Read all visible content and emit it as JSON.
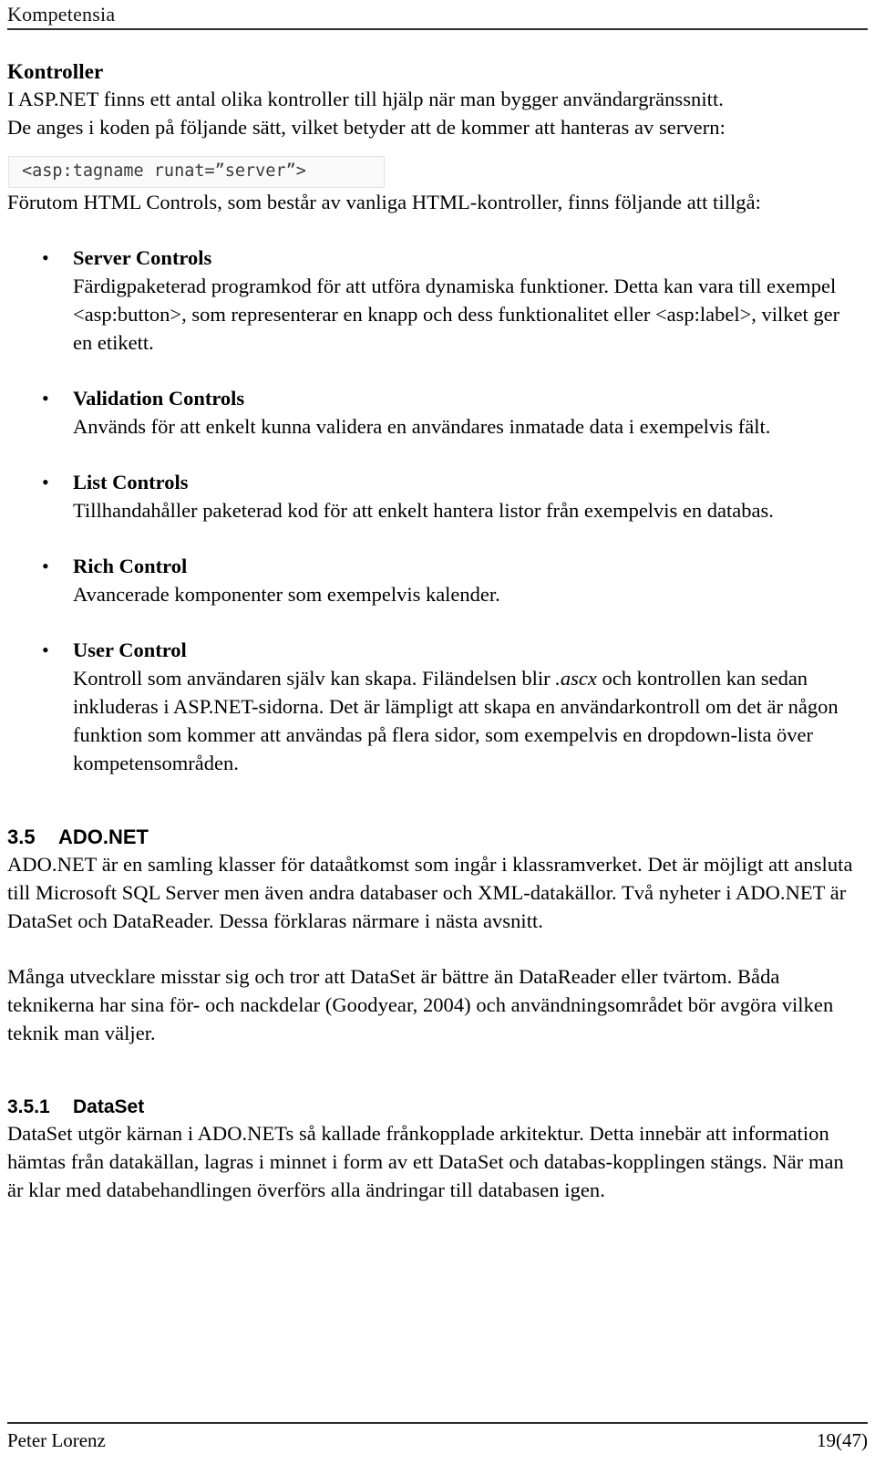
{
  "header": {
    "running_title": "Kompetensia"
  },
  "sections": {
    "kontroller": {
      "heading": "Kontroller",
      "intro_line1": "I ASP.NET finns ett antal olika kontroller till hjälp när man bygger användargränssnitt.",
      "intro_line2": "De anges i koden på följande sätt, vilket betyder att de kommer att hanteras av servern:",
      "code_snippet": "<asp:tagname runat=”server”>",
      "after_code": "Förutom HTML Controls, som består av vanliga HTML-kontroller, finns följande att tillgå:",
      "bullet_marker": "•",
      "items": [
        {
          "title": "Server Controls",
          "body": "Färdigpaketerad programkod för att utföra dynamiska funktioner. Detta kan vara till exempel <asp:button>, som representerar en knapp och dess funktionalitet eller <asp:label>, vilket ger en etikett."
        },
        {
          "title": "Validation Controls",
          "body": "Används för att enkelt kunna validera en användares inmatade data i exempelvis fält."
        },
        {
          "title": "List Controls",
          "body": "Tillhandahåller paketerad kod för att enkelt hantera listor från exempelvis en databas."
        },
        {
          "title": "Rich Control",
          "body": "Avancerade komponenter som exempelvis kalender."
        },
        {
          "title": "User Control",
          "body_part1": "Kontroll som användaren själv kan skapa. Filändelsen blir ",
          "body_italic": ".ascx",
          "body_part2": " och kontrollen kan sedan inkluderas i ASP.NET-sidorna. Det är lämpligt att skapa en användarkontroll om det är någon funktion som kommer att användas på flera sidor, som exempelvis en dropdown-lista över kompetensområden."
        }
      ]
    },
    "ado_net": {
      "number": "3.5",
      "title": "ADO.NET",
      "paragraph1": "ADO.NET är en samling klasser för dataåtkomst som ingår i klassramverket. Det är möjligt att ansluta till Microsoft SQL Server men även andra databaser och XML-datakällor. Två nyheter i ADO.NET är DataSet och DataReader. Dessa förklaras närmare i nästa avsnitt.",
      "paragraph2": "Många utvecklare misstar sig och tror att DataSet är bättre än DataReader eller tvärtom. Båda teknikerna har sina för- och nackdelar (Goodyear, 2004) och användningsområdet bör avgöra vilken teknik man väljer."
    },
    "dataset": {
      "number": "3.5.1",
      "title": "DataSet",
      "paragraph1": "DataSet utgör kärnan i ADO.NETs så kallade frånkopplade arkitektur. Detta innebär att information hämtas från datakällan, lagras i minnet i form av ett DataSet och databas-kopplingen stängs. När man är klar med databehandlingen överförs alla ändringar till databasen igen."
    }
  },
  "footer": {
    "author": "Peter Lorenz",
    "page_number": "19(47)"
  }
}
